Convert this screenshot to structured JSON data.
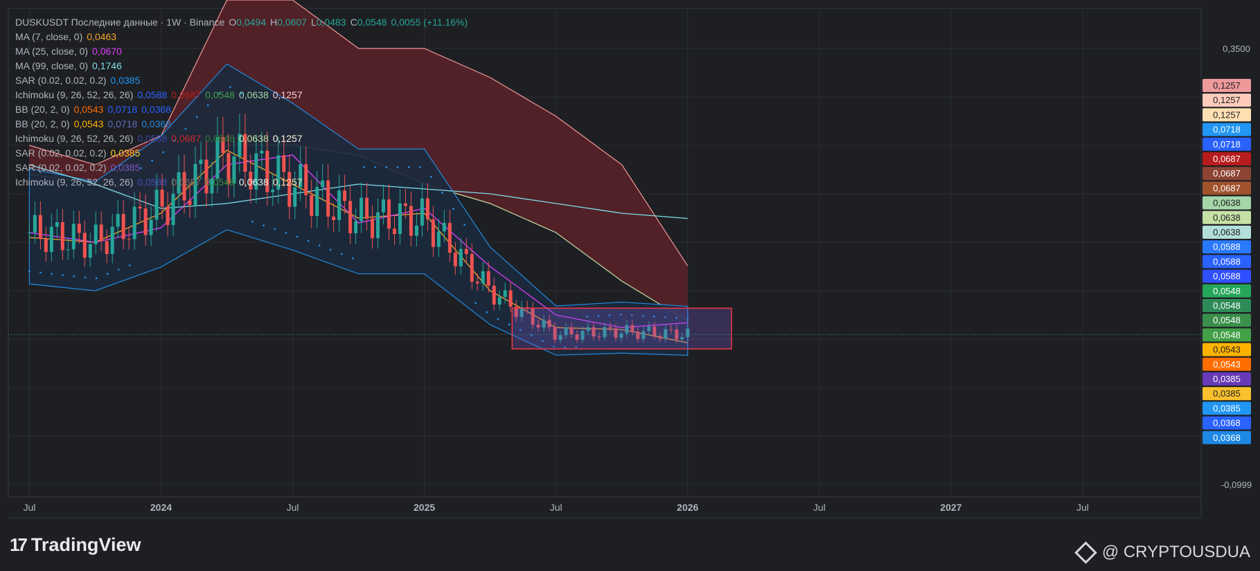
{
  "header": {
    "symbol": "DUSKUSDT Последние данные · 1W · Binance",
    "ohlc": [
      {
        "k": "O",
        "v": "0,0494"
      },
      {
        "k": "H",
        "v": "0,0607"
      },
      {
        "k": "L",
        "v": "0,0483"
      },
      {
        "k": "C",
        "v": "0,0548"
      }
    ],
    "change": "0,0055 (+11.16%)"
  },
  "indicators": [
    {
      "name": "MA (7, close, 0)",
      "values": [
        "0,0463"
      ],
      "colors": [
        "#f7a52c"
      ]
    },
    {
      "name": "MA (25, close, 0)",
      "values": [
        "0,0670"
      ],
      "colors": [
        "#e040fb"
      ]
    },
    {
      "name": "MA (99, close, 0)",
      "values": [
        "0,1746"
      ],
      "colors": [
        "#80deea"
      ]
    },
    {
      "name": "SAR (0.02, 0.02, 0.2)",
      "values": [
        "0,0385"
      ],
      "colors": [
        "#2196f3"
      ]
    },
    {
      "name": "Ichimoku (9, 26, 52, 26, 26)",
      "values": [
        "0,0588",
        "0,0687",
        "0,0548",
        "0,0638",
        "0,1257"
      ],
      "colors": [
        "#2962ff",
        "#b71c1c",
        "#43a047",
        "#a5d6a7",
        "#ffcdd2"
      ]
    },
    {
      "name": "BB (20, 2, 0)",
      "values": [
        "0,0543",
        "0,0718",
        "0,0368"
      ],
      "colors": [
        "#ff6d00",
        "#2962ff",
        "#2962ff"
      ]
    },
    {
      "name": "BB (20, 2, 0)",
      "values": [
        "0,0543",
        "0,0718",
        "0,0368"
      ],
      "colors": [
        "#ffb300",
        "#5c6bc0",
        "#1e88e5"
      ]
    },
    {
      "name": "Ichimoku (9, 26, 52, 26, 26)",
      "values": [
        "0,0588",
        "0,0687",
        "0,0548",
        "0,0638",
        "0,1257"
      ],
      "colors": [
        "#3949ab",
        "#c62828",
        "#2e7d32",
        "#c5e1a5",
        "#fff3e0"
      ]
    },
    {
      "name": "SAR (0.02, 0.02, 0.2)",
      "values": [
        "0,0385"
      ],
      "colors": [
        "#ffca28"
      ]
    },
    {
      "name": "SAR (0.02, 0.02, 0.2)",
      "values": [
        "0,0385"
      ],
      "colors": [
        "#7e57c2"
      ]
    },
    {
      "name": "Ichimoku (9, 26, 52, 26, 26)",
      "values": [
        "0,0588",
        "0,0687",
        "0,0548",
        "0,0638",
        "0,1257"
      ],
      "colors": [
        "#3f51b5",
        "#8d6e63",
        "#388e3c",
        "#e8f5e9",
        "#ffe0b2"
      ]
    }
  ],
  "price_scale": {
    "ticks": [
      "0,3500",
      "-0,0999"
    ],
    "tick_values": [
      0.35,
      -0.0999
    ],
    "labels": [
      {
        "text": "0,1257",
        "bg": "#ef9a9a",
        "fg": "#1e1f23"
      },
      {
        "text": "0,1257",
        "bg": "#ffccbc",
        "fg": "#1e1f23"
      },
      {
        "text": "0,1257",
        "bg": "#ffe0b2",
        "fg": "#1e1f23"
      },
      {
        "text": "0,0718",
        "bg": "#2196f3",
        "fg": "#ffffff"
      },
      {
        "text": "0,0718",
        "bg": "#2962ff",
        "fg": "#ffffff"
      },
      {
        "text": "0,0687",
        "bg": "#b71c1c",
        "fg": "#ffffff"
      },
      {
        "text": "0,0687",
        "bg": "#8d4433",
        "fg": "#ffffff"
      },
      {
        "text": "0,0687",
        "bg": "#a0522d",
        "fg": "#ffffff"
      },
      {
        "text": "0,0638",
        "bg": "#a5d6a7",
        "fg": "#1e1f23"
      },
      {
        "text": "0,0638",
        "bg": "#c5e1a5",
        "fg": "#1e1f23"
      },
      {
        "text": "0,0638",
        "bg": "#b2dfdb",
        "fg": "#1e1f23"
      },
      {
        "text": "0,0588",
        "bg": "#2979ff",
        "fg": "#ffffff"
      },
      {
        "text": "0,0588",
        "bg": "#2962ff",
        "fg": "#ffffff"
      },
      {
        "text": "0,0588",
        "bg": "#304ffe",
        "fg": "#ffffff"
      },
      {
        "text": "0,0548",
        "bg": "#26a65b",
        "fg": "#ffffff"
      },
      {
        "text": "0,0548",
        "bg": "#2e8b57",
        "fg": "#ffffff"
      },
      {
        "text": "0,0548",
        "bg": "#3a8f4a",
        "fg": "#ffffff"
      },
      {
        "text": "0,0548",
        "bg": "#43a047",
        "fg": "#ffffff"
      },
      {
        "text": "0,0543",
        "bg": "#ffb300",
        "fg": "#1e1f23"
      },
      {
        "text": "0,0543",
        "bg": "#ff6d00",
        "fg": "#ffffff"
      },
      {
        "text": "0,0385",
        "bg": "#673ab7",
        "fg": "#ffffff"
      },
      {
        "text": "0,0385",
        "bg": "#fbc02d",
        "fg": "#1e1f23"
      },
      {
        "text": "0,0385",
        "bg": "#2196f3",
        "fg": "#ffffff"
      },
      {
        "text": "0,0368",
        "bg": "#2962ff",
        "fg": "#ffffff"
      },
      {
        "text": "0,0368",
        "bg": "#1e88e5",
        "fg": "#ffffff"
      }
    ]
  },
  "time_scale": {
    "labels": [
      "Jul",
      "2024",
      "Jul",
      "2025",
      "Jul",
      "2026",
      "Jul",
      "2027",
      "Jul"
    ],
    "bold": [
      false,
      true,
      false,
      true,
      false,
      true,
      false,
      true,
      false
    ]
  },
  "chart_data": {
    "type": "candlestick",
    "symbol": "DUSKUSDT",
    "interval": "1W",
    "exchange": "Binance",
    "ylim": [
      -0.0999,
      0.35
    ],
    "last_price": 0.0548,
    "x": [
      "2023-07",
      "2023-10",
      "2024-01",
      "2024-04",
      "2024-07",
      "2024-10",
      "2025-01",
      "2025-04",
      "2025-07",
      "2025-10",
      "2026-01"
    ],
    "close": [
      0.16,
      0.15,
      0.185,
      0.24,
      0.21,
      0.175,
      0.175,
      0.1,
      0.055,
      0.058,
      0.0548
    ],
    "series": [
      {
        "name": "MA (7, close, 0)",
        "values": [
          0.155,
          0.15,
          0.18,
          0.245,
          0.21,
          0.175,
          0.18,
          0.1,
          0.062,
          0.06,
          0.0463
        ]
      },
      {
        "name": "MA (25, close, 0)",
        "values": [
          0.16,
          0.15,
          0.165,
          0.23,
          0.24,
          0.17,
          0.185,
          0.125,
          0.075,
          0.062,
          0.067
        ]
      },
      {
        "name": "MA (99, close, 0)",
        "values": [
          0.23,
          0.21,
          0.185,
          0.19,
          0.2,
          0.21,
          0.205,
          0.2,
          0.19,
          0.18,
          0.1746
        ]
      }
    ],
    "cloud_top": [
      0.25,
      0.23,
      0.26,
      0.4,
      0.4,
      0.35,
      0.35,
      0.32,
      0.28,
      0.23,
      0.1257
    ],
    "cloud_bottom": [
      0.22,
      0.21,
      0.18,
      0.25,
      0.25,
      0.24,
      0.21,
      0.19,
      0.16,
      0.11,
      0.0687
    ],
    "highlight_box": {
      "x": [
        "2025-05",
        "2026-03"
      ],
      "y": [
        0.04,
        0.082
      ]
    }
  },
  "footer": {
    "brand": "TradingView",
    "credit": "@ CRYPTOUSDUA"
  },
  "colors": {
    "background": "#1e1f23",
    "grid": "#2a2d35",
    "up": "#26a69a",
    "down": "#ef5350",
    "cloud": "#5b2228",
    "bb_fill": "#1b2a3d"
  }
}
